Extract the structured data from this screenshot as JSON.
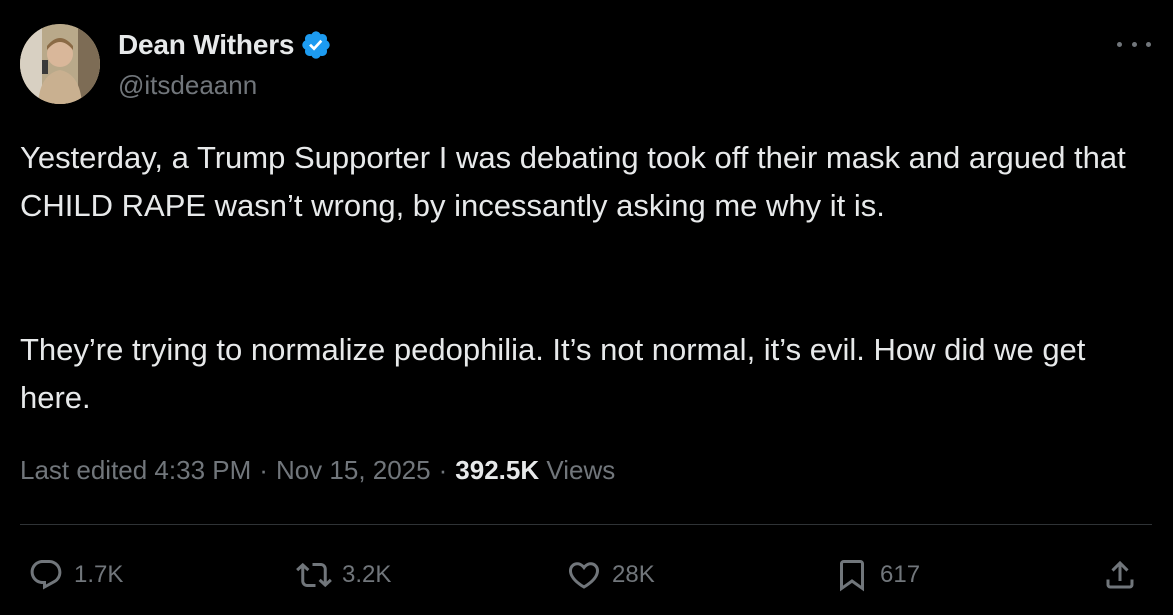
{
  "author": {
    "display_name": "Dean Withers",
    "handle": "@itsdeaann",
    "verified": true,
    "badge_color": "#1d9bf0"
  },
  "tweet": {
    "paragraph_1": "Yesterday, a Trump Supporter I was debating took off their mask and argued that CHILD RAPE wasn’t wrong, by incessantly asking me why it is.",
    "paragraph_2": "They’re trying to normalize pedophilia. It’s not normal, it’s evil. How did we get here."
  },
  "meta": {
    "edited_label": "Last edited 4:33 PM",
    "separator": "·",
    "date": "Nov 15, 2025",
    "views_count": "392.5K",
    "views_label": "Views"
  },
  "actions": {
    "reply": {
      "icon": "reply-icon",
      "count": "1.7K"
    },
    "repost": {
      "icon": "repost-icon",
      "count": "3.2K"
    },
    "like": {
      "icon": "heart-icon",
      "count": "28K"
    },
    "bookmark": {
      "icon": "bookmark-icon",
      "count": "617"
    },
    "share": {
      "icon": "share-icon"
    }
  },
  "colors": {
    "background": "#000000",
    "text_primary": "#e7e9ea",
    "text_secondary": "#71767b",
    "divider": "#2f3336"
  }
}
